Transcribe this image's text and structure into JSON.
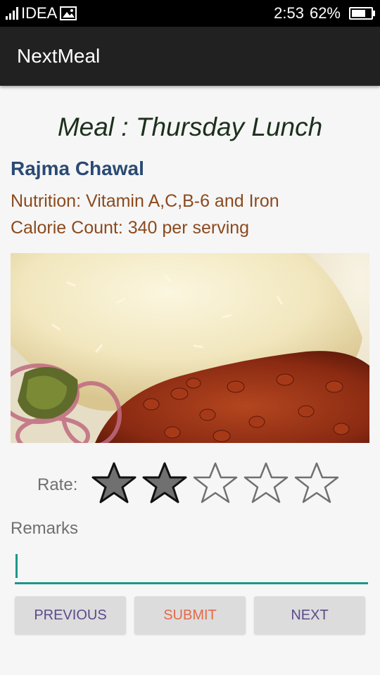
{
  "status_bar": {
    "carrier": "IDEA",
    "time": "2:53",
    "battery": "62%",
    "icons": [
      "signal-icon",
      "gallery-icon",
      "battery-icon"
    ]
  },
  "app_bar": {
    "title": "NextMeal"
  },
  "meal": {
    "title": "Meal : Thursday Lunch",
    "dish": "Rajma Chawal",
    "nutrition": "Nutrition: Vitamin A,C,B-6 and Iron",
    "calories": "Calorie Count: 340 per serving"
  },
  "rating": {
    "label": "Rate:",
    "value": 2,
    "max": 5
  },
  "remarks": {
    "label": "Remarks",
    "value": ""
  },
  "buttons": {
    "previous": "PREVIOUS",
    "submit": "SUBMIT",
    "next": "NEXT"
  },
  "colors": {
    "accent": "#1b978a",
    "dish": "#2a4a74",
    "nutrition": "#8b4a1e",
    "submit": "#e46a49",
    "nav_buttons": "#5b4a8b",
    "star_filled": "#707070"
  }
}
